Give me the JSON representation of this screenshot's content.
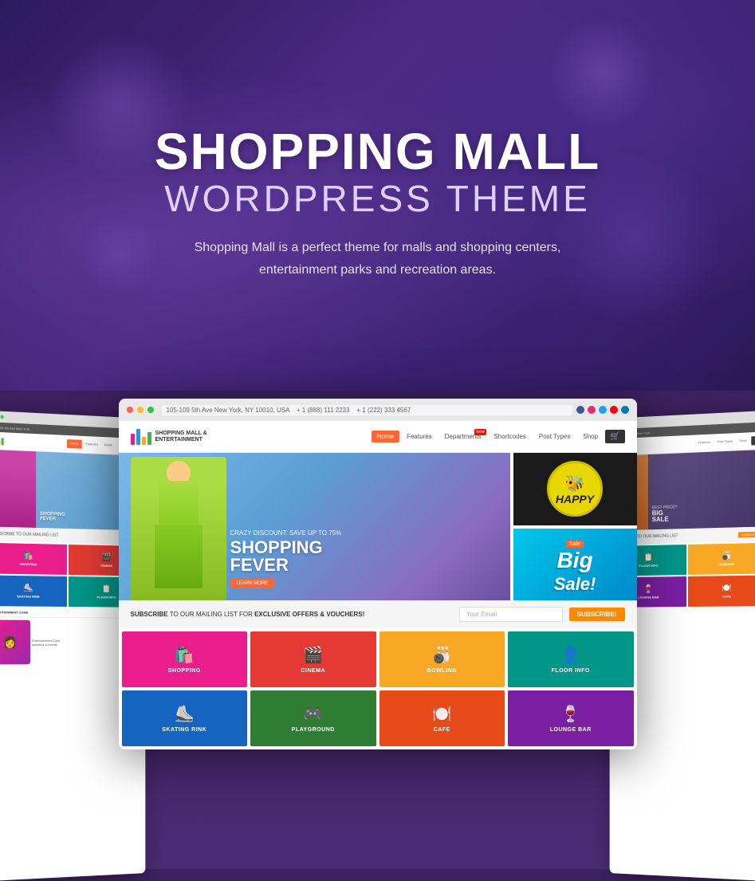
{
  "hero": {
    "title_main": "SHOPPING MALL",
    "title_sub": "WORDPRESS THEME",
    "description": "Shopping Mall is a perfect theme for malls and shopping centers, entertainment parks and recreation areas."
  },
  "browser": {
    "address_text": "105-109 5th Ave New York, NY 10010, USA",
    "phone1": "+ 1 (888) 111 2233",
    "phone2": "+ 1 (222) 333 4567"
  },
  "nav": {
    "logo_text": "SHOPPING MALL &\nENTERTAINMENT",
    "menu_items": [
      "Home",
      "Features",
      "Departments",
      "Shortcodes",
      "Post Types",
      "Shop"
    ],
    "active_item": "Home",
    "badge_item": "Departments",
    "badge_text": "New!"
  },
  "slider": {
    "discount_text": "CRAZY DISCOUNT: SAVE UP TO 75%",
    "big_text": "SHOPPING\nFEVER",
    "button_label": "LEARN MORE",
    "side_panel_1": {
      "emoji": "🐝",
      "text": "HAPPY"
    },
    "side_panel_2": {
      "badge": "Sale",
      "big_text": "BIG",
      "sub_text": "Sale!"
    }
  },
  "subscribe": {
    "text": "SUBSCRIBE TO OUR MAILING LIST FOR EXCLUSIVE OFFERS & VOUCHERS!",
    "input_placeholder": "Your Email",
    "button_label": "SUBSCRIBE!"
  },
  "departments": {
    "tiles": [
      {
        "icon": "🛍️",
        "label": "SHOPPING",
        "color": "tile-pink"
      },
      {
        "icon": "🎬",
        "label": "CINEMA",
        "color": "tile-red"
      },
      {
        "icon": "🎳",
        "label": "BOWLING",
        "color": "tile-yellow"
      },
      {
        "icon": "📋",
        "label": "FLOOR INFO",
        "color": "tile-teal"
      },
      {
        "icon": "⛸️",
        "label": "SKATING RINK",
        "color": "tile-blue"
      },
      {
        "icon": "🎮",
        "label": "PLAYGROUND",
        "color": "tile-green"
      },
      {
        "icon": "🍽️",
        "label": "CAFE",
        "color": "tile-orange"
      },
      {
        "icon": "🍷",
        "label": "LOUNGE BAR",
        "color": "tile-purple"
      }
    ]
  }
}
